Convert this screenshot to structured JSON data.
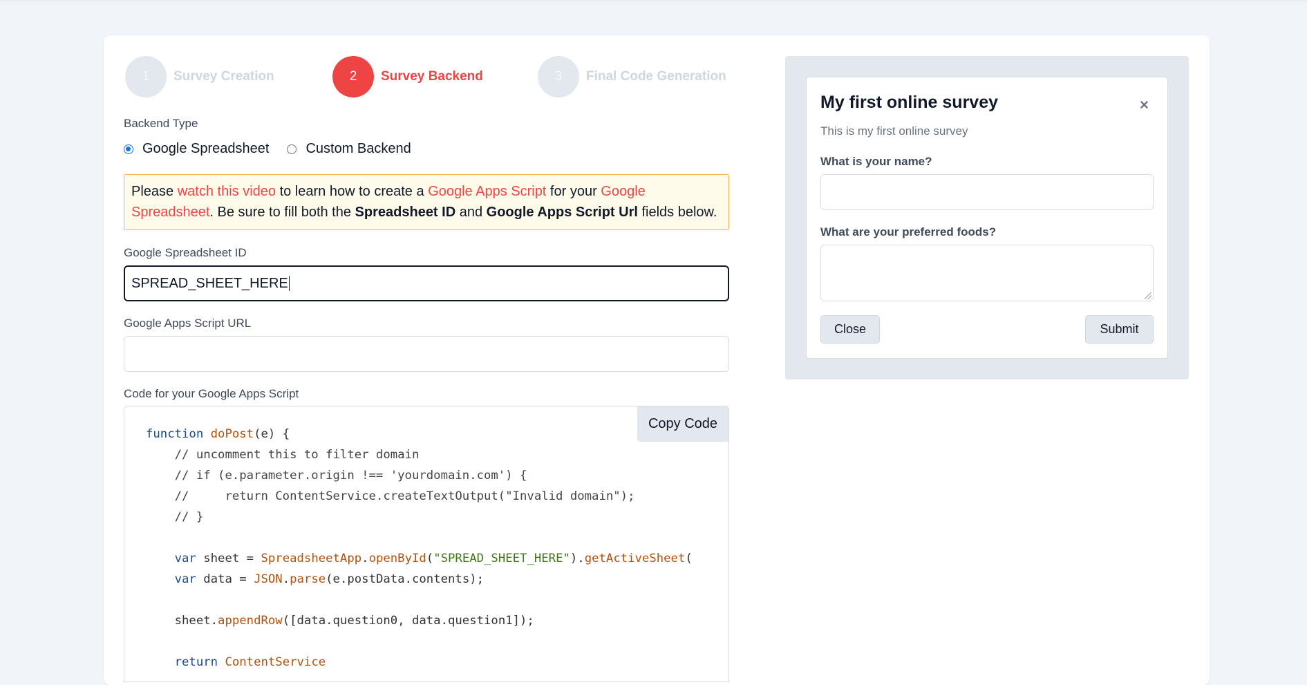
{
  "stepper": {
    "steps": [
      {
        "number": "1",
        "label": "Survey Creation",
        "state": "inactive"
      },
      {
        "number": "2",
        "label": "Survey Backend",
        "state": "active"
      },
      {
        "number": "3",
        "label": "Final Code Generation",
        "state": "inactive"
      }
    ]
  },
  "backend": {
    "type_label": "Backend Type",
    "options": [
      {
        "label": "Google Spreadsheet",
        "checked": true
      },
      {
        "label": "Custom Backend",
        "checked": false
      }
    ]
  },
  "notice": {
    "text_1": "Please ",
    "link_video": "watch this video",
    "text_2": " to learn how to create a ",
    "link_apps_script": "Google Apps Script",
    "text_3": " for your ",
    "link_spreadsheet": "Google Spreadsheet",
    "text_4": ". Be sure to fill both the ",
    "bold_1": "Spreadsheet ID",
    "text_5": " and ",
    "bold_2": "Google Apps Script Url",
    "text_6": " fields below."
  },
  "fields": {
    "spreadsheet_id_label": "Google Spreadsheet ID",
    "spreadsheet_id_value": "SPREAD_SHEET_HERE",
    "script_url_label": "Google Apps Script URL",
    "script_url_value": ""
  },
  "code_section": {
    "label": "Code for your Google Apps Script",
    "copy_button": "Copy Code",
    "lines": [
      [
        [
          "kw",
          "function"
        ],
        [
          "p",
          " "
        ],
        [
          "fn",
          "doPost"
        ],
        [
          "p",
          "(e) {"
        ]
      ],
      [
        [
          "cm",
          "    // uncomment this to filter domain"
        ]
      ],
      [
        [
          "cm",
          "    // if (e.parameter.origin !== 'yourdomain.com') {"
        ]
      ],
      [
        [
          "cm",
          "    //     return ContentService.createTextOutput(\"Invalid domain\");"
        ]
      ],
      [
        [
          "cm",
          "    // }"
        ]
      ],
      [
        [
          "p",
          ""
        ]
      ],
      [
        [
          "p",
          "    "
        ],
        [
          "kw",
          "var"
        ],
        [
          "p",
          " sheet = "
        ],
        [
          "fn",
          "SpreadsheetApp"
        ],
        [
          "p",
          "."
        ],
        [
          "fn",
          "openById"
        ],
        [
          "p",
          "("
        ],
        [
          "st",
          "\"SPREAD_SHEET_HERE\""
        ],
        [
          "p",
          ")."
        ],
        [
          "fn",
          "getActiveSheet"
        ],
        [
          "p",
          "("
        ]
      ],
      [
        [
          "p",
          "    "
        ],
        [
          "kw",
          "var"
        ],
        [
          "p",
          " data = "
        ],
        [
          "fn",
          "JSON"
        ],
        [
          "p",
          "."
        ],
        [
          "fn",
          "parse"
        ],
        [
          "p",
          "(e.postData.contents);"
        ]
      ],
      [
        [
          "p",
          ""
        ]
      ],
      [
        [
          "p",
          "    sheet."
        ],
        [
          "fn",
          "appendRow"
        ],
        [
          "p",
          "([data.question0, data.question1]);"
        ]
      ],
      [
        [
          "p",
          ""
        ]
      ],
      [
        [
          "p",
          "    "
        ],
        [
          "kw",
          "return"
        ],
        [
          "p",
          " "
        ],
        [
          "fn",
          "ContentService"
        ]
      ]
    ]
  },
  "preview": {
    "title": "My first online survey",
    "close_icon": "×",
    "subtitle": "This is my first online survey",
    "q1_label": "What is your name?",
    "q1_value": "",
    "q2_label": "What are your preferred foods?",
    "q2_value": "",
    "close_button": "Close",
    "submit_button": "Submit"
  },
  "colors": {
    "accent": "#ef4444",
    "page_bg": "#f1f4f8",
    "panel_bg": "#e3e8ef",
    "notice_bg": "#fffbeb",
    "notice_border": "#f9b24b",
    "radio_blue": "#1a73e8"
  }
}
